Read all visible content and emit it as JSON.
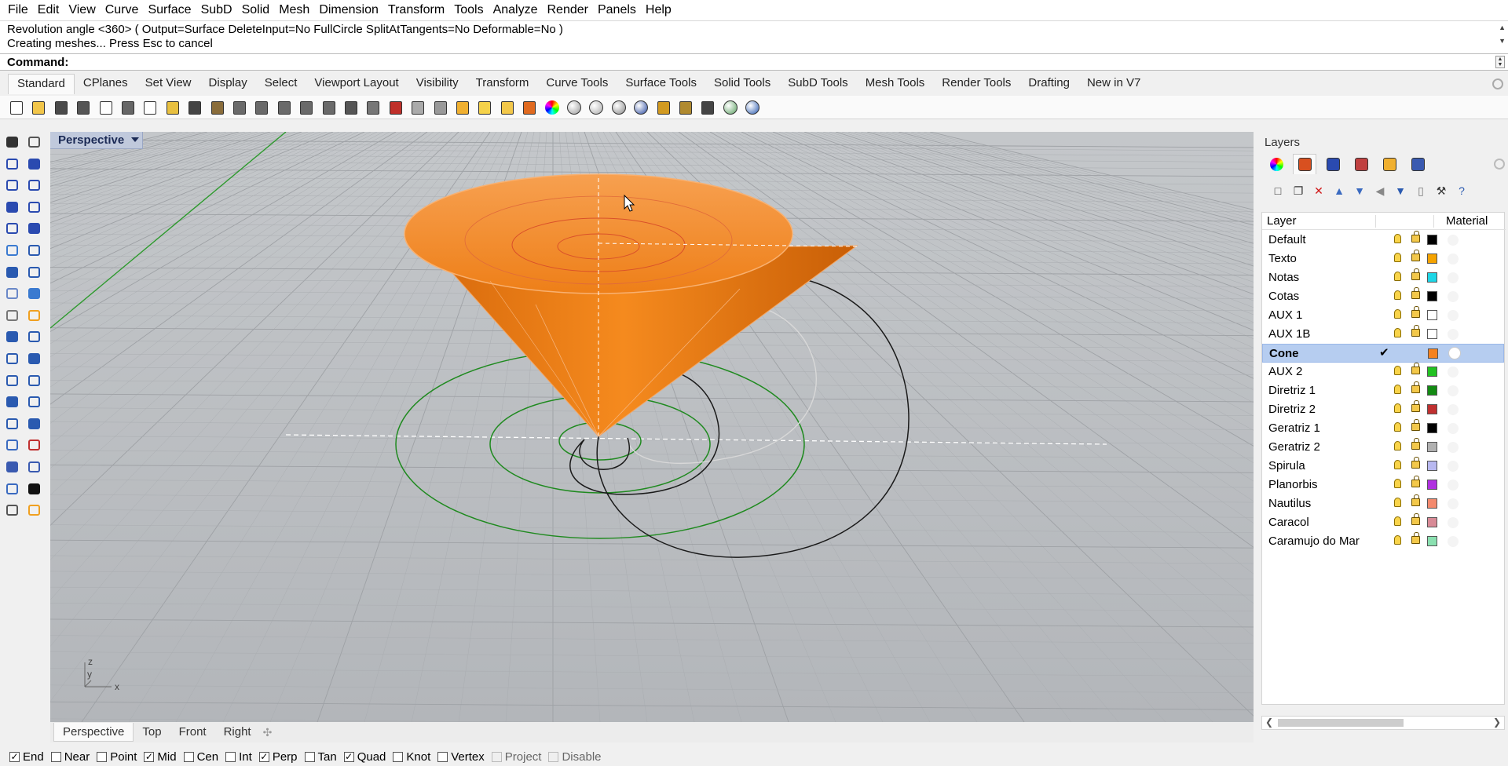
{
  "menu": [
    "File",
    "Edit",
    "View",
    "Curve",
    "Surface",
    "SubD",
    "Solid",
    "Mesh",
    "Dimension",
    "Transform",
    "Tools",
    "Analyze",
    "Render",
    "Panels",
    "Help"
  ],
  "command_history": [
    "Revolution angle <360> ( Output=Surface  DeleteInput=No  FullCircle  SplitAtTangents=No  Deformable=No )",
    "Creating meshes... Press Esc to cancel"
  ],
  "command_prompt": "Command:",
  "toolbar_tabs": [
    "Standard",
    "CPlanes",
    "Set View",
    "Display",
    "Select",
    "Viewport Layout",
    "Visibility",
    "Transform",
    "Curve Tools",
    "Surface Tools",
    "Solid Tools",
    "SubD Tools",
    "Mesh Tools",
    "Render Tools",
    "Drafting",
    "New in V7"
  ],
  "active_toolbar_tab": "Standard",
  "toolbar_icons": [
    "new-file-icon",
    "open-icon",
    "save-icon",
    "print-icon",
    "import-icon",
    "cut-icon",
    "copy-icon",
    "paste-icon",
    "undo-icon",
    "pan-hand-icon",
    "move-view-icon",
    "zoom-icon",
    "zoom-window-icon",
    "zoom-extents-icon",
    "zoom-selected-icon",
    "rotate-view-icon",
    "four-views-icon",
    "car-icon",
    "options-icon",
    "point-icon",
    "object-props-icon",
    "light-icon",
    "lock-icon",
    "layer-icon",
    "color-wheel-icon",
    "render-sphere-icon",
    "material-sphere-icon",
    "env-sphere-icon",
    "blue-sphere-icon",
    "flashlight-icon",
    "settings-gears-icon",
    "grid-icon",
    "globe-icon",
    "help-icon"
  ],
  "viewport": {
    "label": "Perspective",
    "axis_x": "x",
    "axis_y": "y",
    "axis_z": "z"
  },
  "viewport_tabs": [
    "Perspective",
    "Top",
    "Front",
    "Right"
  ],
  "active_viewport_tab": "Perspective",
  "osnaps": [
    {
      "label": "End",
      "checked": true,
      "enabled": true
    },
    {
      "label": "Near",
      "checked": false,
      "enabled": true
    },
    {
      "label": "Point",
      "checked": false,
      "enabled": true
    },
    {
      "label": "Mid",
      "checked": true,
      "enabled": true
    },
    {
      "label": "Cen",
      "checked": false,
      "enabled": true
    },
    {
      "label": "Int",
      "checked": false,
      "enabled": true
    },
    {
      "label": "Perp",
      "checked": true,
      "enabled": true
    },
    {
      "label": "Tan",
      "checked": false,
      "enabled": true
    },
    {
      "label": "Quad",
      "checked": true,
      "enabled": true
    },
    {
      "label": "Knot",
      "checked": false,
      "enabled": true
    },
    {
      "label": "Vertex",
      "checked": false,
      "enabled": true
    },
    {
      "label": "Project",
      "checked": false,
      "enabled": false
    },
    {
      "label": "Disable",
      "checked": false,
      "enabled": false
    }
  ],
  "layers_panel": {
    "title": "Layers",
    "col_layer": "Layer",
    "col_material": "Material",
    "tab_icons": [
      "color-wheel-icon",
      "layers-icon",
      "render-icon",
      "brush-icon",
      "folder-icon",
      "camera-icon"
    ],
    "toolbar_icons": [
      "new-layer-icon",
      "new-sublayer-icon",
      "delete-icon",
      "move-up-icon",
      "move-down-icon",
      "collapse-icon",
      "filter-icon",
      "page-icon",
      "tools-icon",
      "help-icon"
    ],
    "layers": [
      {
        "name": "Default",
        "color": "#000000",
        "current": false
      },
      {
        "name": "Texto",
        "color": "#f5a300",
        "current": false
      },
      {
        "name": "Notas",
        "color": "#1ed6e6",
        "current": false
      },
      {
        "name": "Cotas",
        "color": "#000000",
        "current": false
      },
      {
        "name": "AUX 1",
        "color": "#ffffff",
        "current": false
      },
      {
        "name": "AUX 1B",
        "color": "#ffffff",
        "current": false
      },
      {
        "name": "Cone",
        "color": "#f58220",
        "current": true
      },
      {
        "name": "AUX 2",
        "color": "#22c222",
        "current": false
      },
      {
        "name": "Diretriz 1",
        "color": "#138a13",
        "current": false
      },
      {
        "name": "Diretriz 2",
        "color": "#c03030",
        "current": false
      },
      {
        "name": "Geratriz 1",
        "color": "#000000",
        "current": false
      },
      {
        "name": "Geratriz 2",
        "color": "#b0b0b0",
        "current": false
      },
      {
        "name": "Spirula",
        "color": "#b8b8f0",
        "current": false
      },
      {
        "name": "Planorbis",
        "color": "#b030e0",
        "current": false
      },
      {
        "name": "Nautilus",
        "color": "#f48a6e",
        "current": false
      },
      {
        "name": "Caracol",
        "color": "#d88a96",
        "current": false
      },
      {
        "name": "Caramujo do Mar",
        "color": "#8ae0b0",
        "current": false
      }
    ]
  }
}
